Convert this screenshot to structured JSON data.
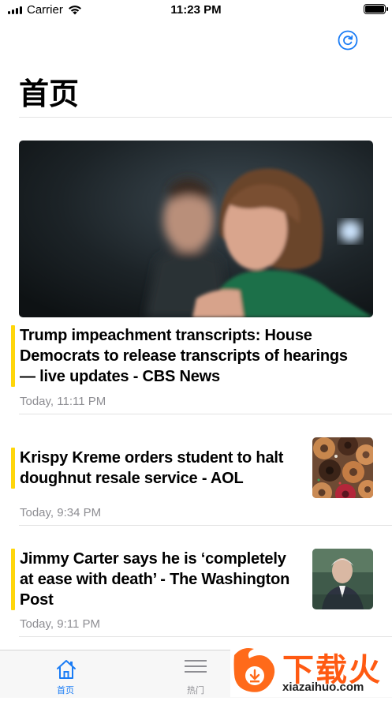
{
  "status_bar": {
    "carrier": "Carrier",
    "time": "11:23 PM"
  },
  "header": {
    "title": "首页",
    "refresh_icon": "refresh-icon"
  },
  "articles": [
    {
      "headline_lines": [
        "Trump impeachment transcripts: House",
        "Democrats to release transcripts of hearings",
        "— live updates - CBS News"
      ],
      "time": "Today, 11:11 PM",
      "image": "large"
    },
    {
      "headline_lines": [
        "Krispy Kreme orders student to halt",
        "doughnut resale service - AOL"
      ],
      "time": "Today, 9:34 PM",
      "image": "thumbnail"
    },
    {
      "headline_lines": [
        "Jimmy Carter says he is ‘completely",
        "at ease with death’ - The Washington",
        "Post"
      ],
      "time": "Today, 9:11 PM",
      "image": "thumbnail"
    }
  ],
  "tabs": [
    {
      "label": "首页",
      "icon": "home-icon",
      "selected": true
    },
    {
      "label": "热门",
      "icon": "list-icon",
      "selected": false
    }
  ],
  "watermark": {
    "text": "下载火",
    "url": "xiazaihuo.com"
  },
  "colors": {
    "accent": "#ffd60a",
    "tint": "#1a7cf5",
    "secondary_text": "#8e8e93"
  }
}
